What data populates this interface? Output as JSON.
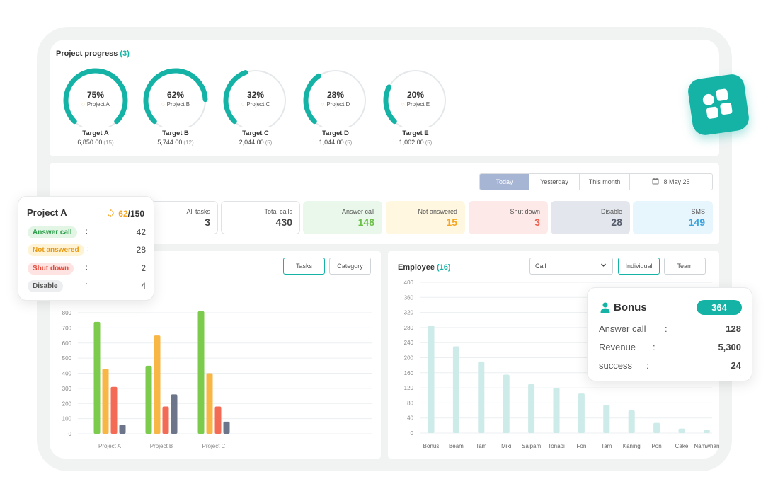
{
  "project_progress": {
    "title": "Project progress",
    "count": "(3)",
    "projects": [
      {
        "pct": "75%",
        "fraction": 0.75,
        "name": "Project A",
        "target": "Target A",
        "value": "6,850.00",
        "n": "(15)"
      },
      {
        "pct": "62%",
        "fraction": 0.62,
        "name": "Project B",
        "target": "Target B",
        "value": "5,744.00",
        "n": "(12)"
      },
      {
        "pct": "32%",
        "fraction": 0.32,
        "name": "Project C",
        "target": "Target C",
        "value": "2,044.00",
        "n": "(5)"
      },
      {
        "pct": "28%",
        "fraction": 0.28,
        "name": "Project D",
        "target": "Target D",
        "value": "1,044.00",
        "n": "(5)"
      },
      {
        "pct": "20%",
        "fraction": 0.2,
        "name": "Project E",
        "target": "Target E",
        "value": "1,002.00",
        "n": "(5)"
      }
    ]
  },
  "date_filter": {
    "tabs": [
      "Today",
      "Yesterday",
      "This month"
    ],
    "active": "Today",
    "date": "8 May 25"
  },
  "stats": [
    {
      "label": "All tasks",
      "value": "3",
      "bg": "#ffffff",
      "color": "#444444"
    },
    {
      "label": "Total calls",
      "value": "430",
      "bg": "#ffffff",
      "color": "#444444"
    },
    {
      "label": "Answer call",
      "value": "148",
      "bg": "#e9f8ea",
      "color": "#6cc04a"
    },
    {
      "label": "Not answered",
      "value": "15",
      "bg": "#fff7df",
      "color": "#f5a623"
    },
    {
      "label": "Shut down",
      "value": "3",
      "bg": "#fde9e8",
      "color": "#f0604f"
    },
    {
      "label": "Disable",
      "value": "28",
      "bg": "#e3e6ec",
      "color": "#555c6b"
    },
    {
      "label": "SMS",
      "value": "149",
      "bg": "#e7f5fc",
      "color": "#3ba3dd"
    }
  ],
  "left_chart": {
    "buttons": [
      "Tasks",
      "Category"
    ],
    "active": "Tasks"
  },
  "right_chart": {
    "title": "Employee",
    "count": "(16)",
    "select_value": "Call",
    "buttons": [
      "Individual",
      "Team"
    ],
    "active": "Individual"
  },
  "chart_data": [
    {
      "type": "bar",
      "categories": [
        "Project A",
        "Project B",
        "Project C"
      ],
      "y_ticks": [
        0,
        100,
        200,
        300,
        400,
        500,
        600,
        700,
        800
      ],
      "ylim": [
        0,
        800
      ],
      "series": [
        {
          "color": "#7ccb4d",
          "values": [
            740,
            450,
            810
          ]
        },
        {
          "color": "#f8b645",
          "values": [
            430,
            650,
            400
          ]
        },
        {
          "color": "#f46b55",
          "values": [
            310,
            180,
            180
          ]
        },
        {
          "color": "#6c7589",
          "values": [
            60,
            260,
            80
          ]
        }
      ]
    },
    {
      "type": "bar",
      "categories": [
        "Bonus",
        "Beam",
        "Tam",
        "Miki",
        "Saipam",
        "Tonaoi",
        "Fon",
        "Tam",
        "Kaning",
        "Pon",
        "Cake",
        "Namwhan"
      ],
      "y_ticks": [
        0,
        40,
        80,
        120,
        160,
        200,
        240,
        280,
        320,
        360,
        400
      ],
      "ylim": [
        0,
        400
      ],
      "color": "#cdebe8",
      "values": [
        285,
        230,
        190,
        155,
        130,
        120,
        105,
        75,
        60,
        27,
        12,
        8
      ]
    }
  ],
  "project_a_card": {
    "title": "Project A",
    "current": "62",
    "total": "/150",
    "rows": [
      {
        "label": "Answer call",
        "value": "42",
        "bg": "#e3f6e6",
        "color": "#2e9e4c"
      },
      {
        "label": "Not answered",
        "value": "28",
        "bg": "#fff3d6",
        "color": "#e69a14"
      },
      {
        "label": "Shut down",
        "value": "2",
        "bg": "#fde4e2",
        "color": "#e5493a"
      },
      {
        "label": "Disable",
        "value": "4",
        "bg": "#eceef0",
        "color": "#555555"
      }
    ]
  },
  "bonus_card": {
    "title": "Bonus",
    "badge": "364",
    "rows": [
      {
        "label": "Answer call",
        "value": "128"
      },
      {
        "label": "Revenue",
        "value": "5,300"
      },
      {
        "label": "success",
        "value": "24"
      }
    ]
  },
  "icons": {
    "user": "user-icon",
    "calendar": "calendar-icon",
    "spinner": "spinner-icon",
    "apps": "apps-icon",
    "chevron": "chevron-down-icon"
  },
  "colors": {
    "accent": "#14b3a6",
    "track": "#e4e8ea"
  }
}
